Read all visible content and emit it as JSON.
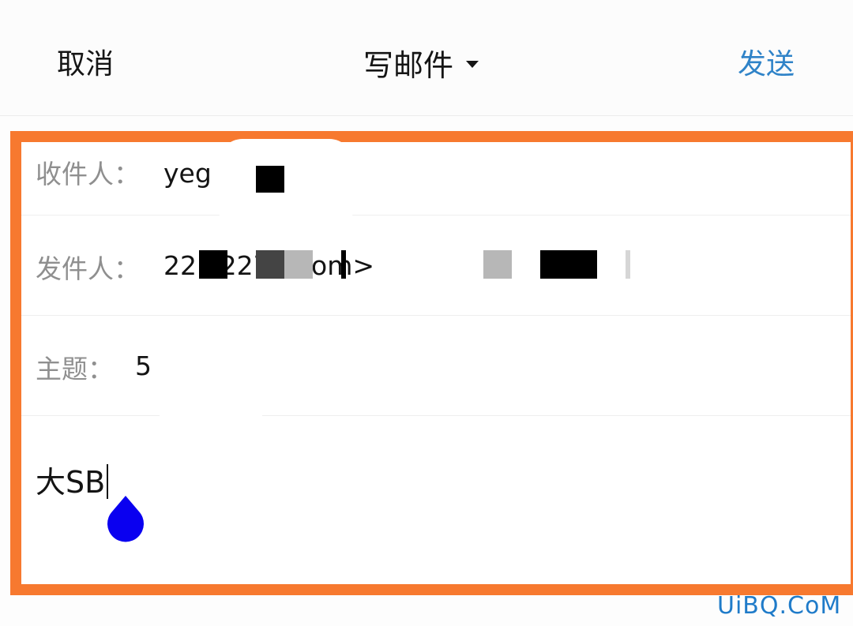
{
  "header": {
    "cancel_label": "取消",
    "title": "写邮件",
    "send_label": "发送"
  },
  "form": {
    "recipient_label": "收件人：",
    "recipient_value": "yeg",
    "sender_label": "发件人：",
    "sender_value": "22 k22702 om>",
    "subject_label": "主题：",
    "subject_value": "5"
  },
  "body": {
    "text": "大SB"
  },
  "watermark": "UiBQ.CoM",
  "colors": {
    "accent": "#2f83c8",
    "highlight_frame": "#f7792f",
    "handle": "#0a00f0"
  }
}
